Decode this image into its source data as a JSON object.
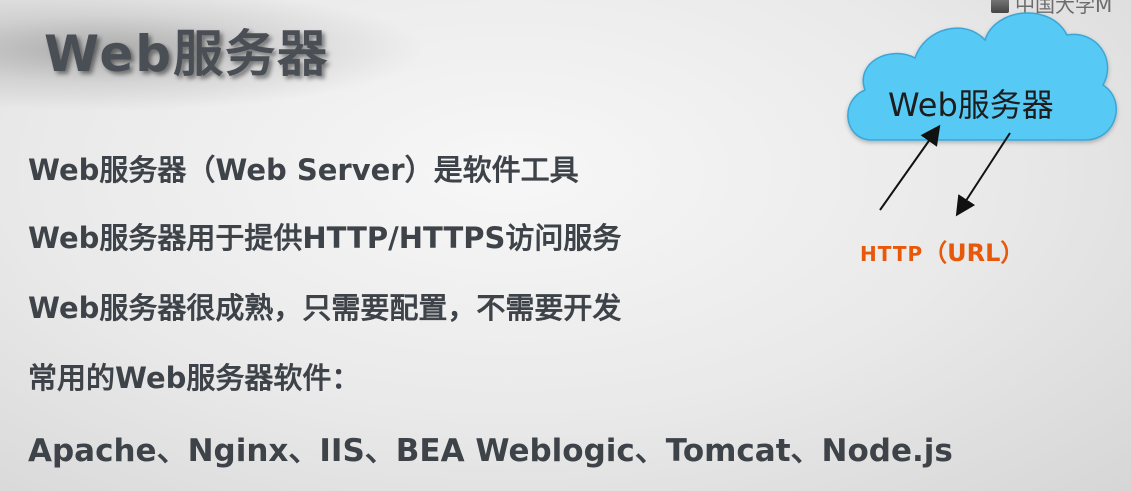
{
  "slide": {
    "title": "Web服务器",
    "lines": [
      "Web服务器（Web Server）是软件工具",
      "Web服务器用于提供HTTP/HTTPS访问服务",
      "Web服务器很成熟，只需要配置，不需要开发",
      "常用的Web服务器软件：",
      "Apache、Nginx、IIS、BEA Weblogic、Tomcat、Node.js"
    ]
  },
  "diagram": {
    "cloud_label": "Web服务器",
    "protocol": "HTTP",
    "url_label": "（URL）",
    "colors": {
      "cloud": "#57c9f5",
      "protocol": "#e8580b"
    }
  },
  "watermark": {
    "text": "中国大学M"
  }
}
